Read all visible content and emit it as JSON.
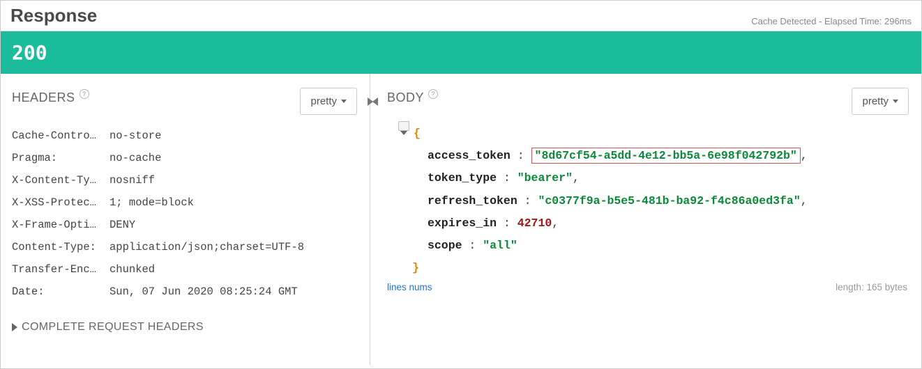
{
  "topbar": {
    "title": "Response",
    "meta": "Cache Detected - Elapsed Time: 296ms"
  },
  "status": {
    "code": "200"
  },
  "headers_panel": {
    "title": "HEADERS",
    "format_label": "pretty",
    "rows": [
      {
        "k": "Cache-Contro…",
        "v": "no-store"
      },
      {
        "k": "Pragma:",
        "v": "no-cache"
      },
      {
        "k": "X-Content-Ty…",
        "v": "nosniff"
      },
      {
        "k": "X-XSS-Protec…",
        "v": "1; mode=block"
      },
      {
        "k": "X-Frame-Opti…",
        "v": "DENY"
      },
      {
        "k": "Content-Type:",
        "v": "application/json;charset=UTF-8"
      },
      {
        "k": "Transfer-Enc…",
        "v": "chunked"
      },
      {
        "k": "Date:",
        "v": "Sun, 07 Jun 2020 08:25:24 GMT"
      }
    ],
    "complete_label": "COMPLETE REQUEST HEADERS"
  },
  "body_panel": {
    "title": "BODY",
    "format_label": "pretty",
    "json": {
      "access_token_key": "access_token",
      "access_token_val": "\"8d67cf54-a5dd-4e12-bb5a-6e98f042792b\"",
      "token_type_key": "token_type",
      "token_type_val": "\"bearer\"",
      "refresh_token_key": "refresh_token",
      "refresh_token_val": "\"c0377f9a-b5e5-481b-ba92-f4c86a0ed3fa\"",
      "expires_in_key": "expires_in",
      "expires_in_val": "42710",
      "scope_key": "scope",
      "scope_val": "\"all\""
    },
    "lines_nums_label": "lines nums",
    "length_label": "length: 165 bytes"
  }
}
